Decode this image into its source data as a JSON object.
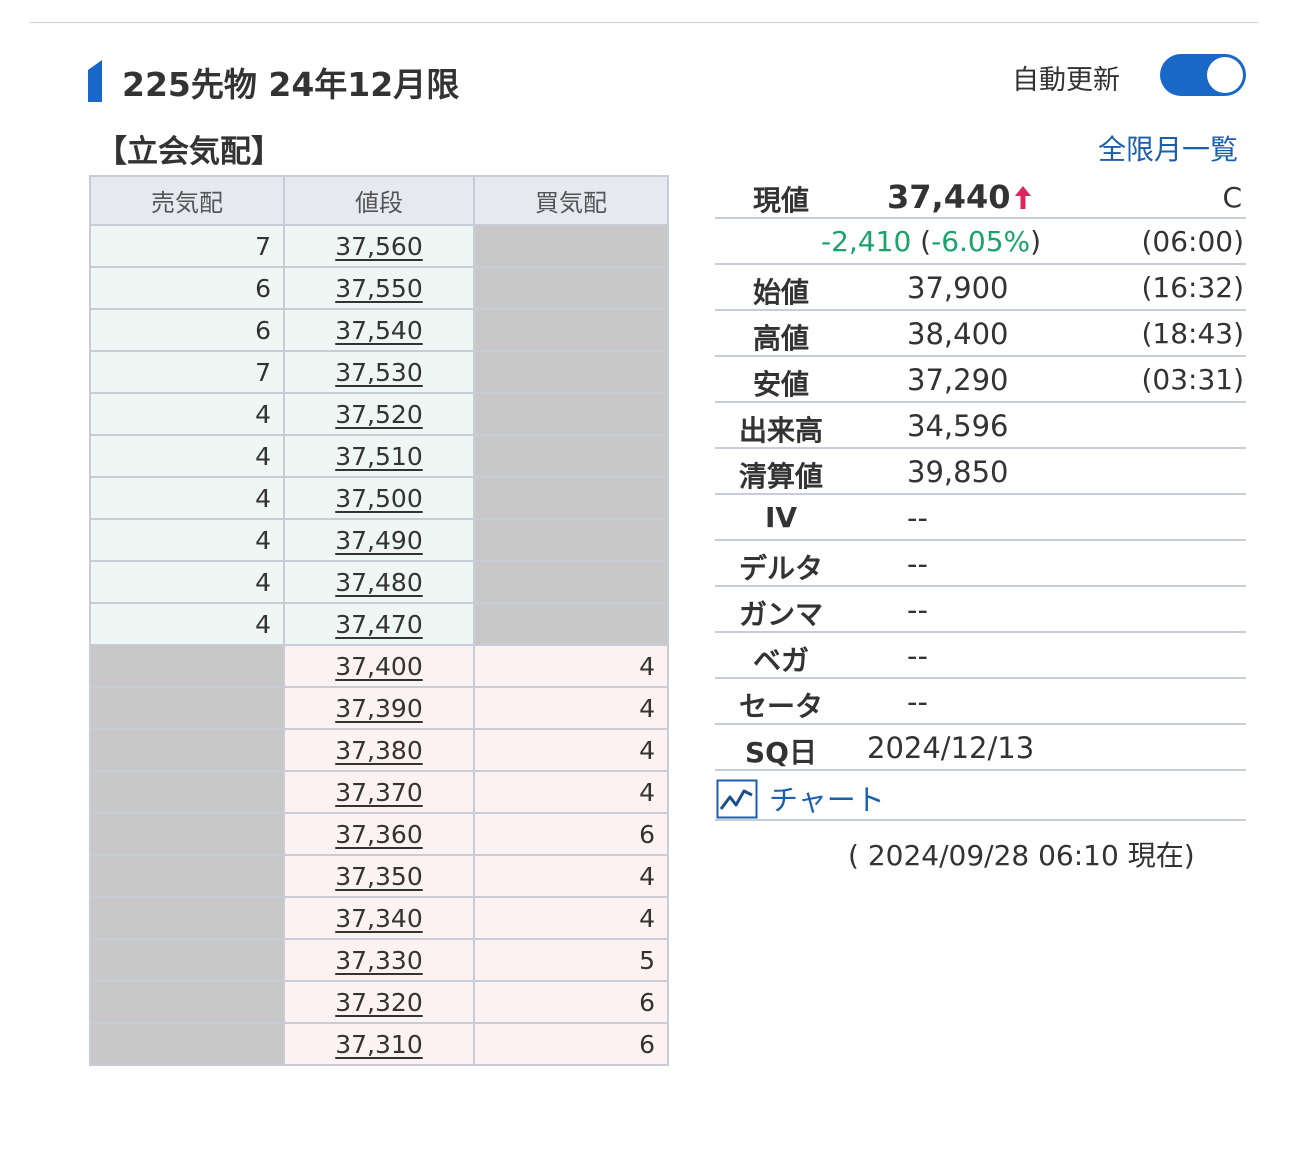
{
  "header": {
    "title": "225先物 24年12月限",
    "auto_update_label": "自動更新",
    "auto_update_on": true,
    "toggle_color": "#1869c7",
    "title_bar_color": "#1869c7"
  },
  "board": {
    "heading": "【立会気配】",
    "all_months_link": "全限月一覧",
    "columns": [
      "売気配",
      "値段",
      "買気配"
    ],
    "asks": [
      {
        "qty": "7",
        "price": "37,560"
      },
      {
        "qty": "6",
        "price": "37,550"
      },
      {
        "qty": "6",
        "price": "37,540"
      },
      {
        "qty": "7",
        "price": "37,530"
      },
      {
        "qty": "4",
        "price": "37,520"
      },
      {
        "qty": "4",
        "price": "37,510"
      },
      {
        "qty": "4",
        "price": "37,500"
      },
      {
        "qty": "4",
        "price": "37,490"
      },
      {
        "qty": "4",
        "price": "37,480"
      },
      {
        "qty": "4",
        "price": "37,470"
      }
    ],
    "bids": [
      {
        "price": "37,400",
        "qty": "4"
      },
      {
        "price": "37,390",
        "qty": "4"
      },
      {
        "price": "37,380",
        "qty": "4"
      },
      {
        "price": "37,370",
        "qty": "4"
      },
      {
        "price": "37,360",
        "qty": "6"
      },
      {
        "price": "37,350",
        "qty": "4"
      },
      {
        "price": "37,340",
        "qty": "4"
      },
      {
        "price": "37,330",
        "qty": "5"
      },
      {
        "price": "37,320",
        "qty": "6"
      },
      {
        "price": "37,310",
        "qty": "6"
      }
    ]
  },
  "quote": {
    "current_label": "現値",
    "current_price": "37,440",
    "current_mark": "C",
    "change": "-2,410",
    "change_pct": "-6.05%",
    "change_time": "(06:00)",
    "rows": [
      {
        "label": "始値",
        "value": "37,900",
        "time": "(16:32)"
      },
      {
        "label": "高値",
        "value": "38,400",
        "time": "(18:43)"
      },
      {
        "label": "安値",
        "value": "37,290",
        "time": "(03:31)"
      },
      {
        "label": "出来高",
        "value": "34,596",
        "time": ""
      },
      {
        "label": "清算値",
        "value": "39,850",
        "time": ""
      },
      {
        "label": "IV",
        "value": "--",
        "time": ""
      },
      {
        "label": "デルタ",
        "value": "--",
        "time": ""
      },
      {
        "label": "ガンマ",
        "value": "--",
        "time": ""
      },
      {
        "label": "ベガ",
        "value": "--",
        "time": ""
      },
      {
        "label": "セータ",
        "value": "--",
        "time": ""
      }
    ],
    "sq_label": "SQ日",
    "sq_date": "2024/12/13",
    "chart_link": "チャート",
    "timestamp": "( 2024/09/28 06:10 現在)",
    "up_color": "#e0245e",
    "change_color": "#1aa36b"
  }
}
